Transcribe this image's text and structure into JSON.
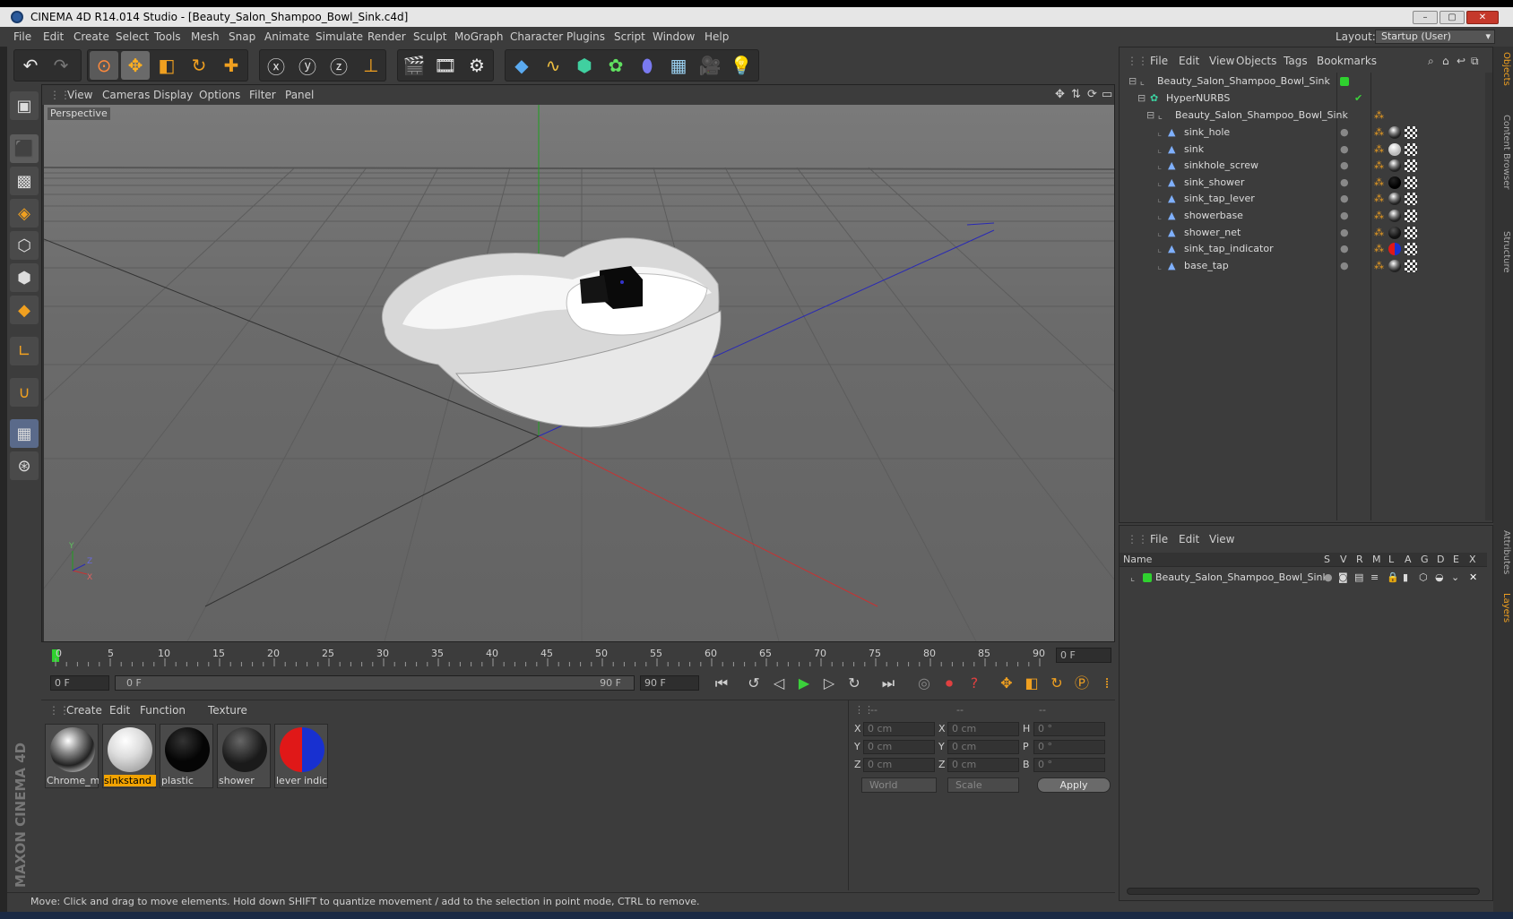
{
  "window": {
    "title": "CINEMA 4D R14.014 Studio - [Beauty_Salon_Shampoo_Bowl_Sink.c4d]",
    "controls": [
      "–",
      "▢",
      "✕"
    ]
  },
  "menubar": {
    "items": [
      "File",
      "Edit",
      "Create",
      "Select",
      "Tools",
      "Mesh",
      "Snap",
      "Animate",
      "Simulate",
      "Render",
      "Sculpt",
      "MoGraph",
      "Character",
      "Plugins",
      "Script",
      "Window",
      "Help"
    ],
    "layout_label": "Layout:",
    "layout_value": "Startup (User)"
  },
  "viewport": {
    "menu": [
      "View",
      "Cameras",
      "Display",
      "Options",
      "Filter",
      "Panel"
    ],
    "label": "Perspective",
    "axis": {
      "y": "Y",
      "z": "Z",
      "x": "X"
    }
  },
  "timeline": {
    "ticks": [
      "0",
      "5",
      "10",
      "15",
      "20",
      "25",
      "30",
      "35",
      "40",
      "45",
      "50",
      "55",
      "60",
      "65",
      "70",
      "75",
      "80",
      "85",
      "90"
    ],
    "current_frame": "0 F",
    "start_field": "0 F",
    "slider_start": "0 F",
    "slider_end": "90 F",
    "end_field": "90 F"
  },
  "materials": {
    "menu": [
      "Create",
      "Edit",
      "Function",
      "Texture"
    ],
    "items": [
      {
        "label": "Chrome_m",
        "kind": "chrome"
      },
      {
        "label": "sinkstand",
        "kind": "white",
        "selected": true
      },
      {
        "label": "plastic",
        "kind": "black"
      },
      {
        "label": "shower",
        "kind": "dark"
      },
      {
        "label": "lever indica",
        "kind": "redblue"
      }
    ]
  },
  "coordinates": {
    "headers": [
      "--",
      "--",
      "--"
    ],
    "rows": [
      {
        "l1": "X",
        "v1": "0 cm",
        "l2": "X",
        "v2": "0 cm",
        "l3": "H",
        "v3": "0 °"
      },
      {
        "l1": "Y",
        "v1": "0 cm",
        "l2": "Y",
        "v2": "0 cm",
        "l3": "P",
        "v3": "0 °"
      },
      {
        "l1": "Z",
        "v1": "0 cm",
        "l2": "Z",
        "v2": "0 cm",
        "l3": "B",
        "v3": "0 °"
      }
    ],
    "mode": "World",
    "scale": "Scale",
    "apply": "Apply"
  },
  "statusbar": {
    "text": "Move: Click and drag to move elements. Hold down SHIFT to quantize movement / add to the selection in point mode, CTRL to remove."
  },
  "objects": {
    "menu": [
      "File",
      "Edit",
      "View",
      "Objects",
      "Tags",
      "Bookmarks"
    ],
    "tree": [
      {
        "name": "Beauty_Salon_Shampoo_Bowl_Sink",
        "level": 0,
        "icon": "null-icon"
      },
      {
        "name": "HyperNURBS",
        "level": 1,
        "icon": "hypernurbs-icon"
      },
      {
        "name": "Beauty_Salon_Shampoo_Bowl_Sink",
        "level": 2,
        "icon": "null-icon"
      },
      {
        "name": "sink_hole",
        "level": 3,
        "icon": "polygon-icon",
        "mat": "chrome"
      },
      {
        "name": "sink",
        "level": 3,
        "icon": "polygon-icon",
        "mat": "white"
      },
      {
        "name": "sinkhole_screw",
        "level": 3,
        "icon": "polygon-icon",
        "mat": "chrome"
      },
      {
        "name": "sink_shower",
        "level": 3,
        "icon": "polygon-icon",
        "mat": "black"
      },
      {
        "name": "sink_tap_lever",
        "level": 3,
        "icon": "polygon-icon",
        "mat": "chrome"
      },
      {
        "name": "showerbase",
        "level": 3,
        "icon": "polygon-icon",
        "mat": "chrome"
      },
      {
        "name": "shower_net",
        "level": 3,
        "icon": "polygon-icon",
        "mat": "dark"
      },
      {
        "name": "sink_tap_indicator",
        "level": 3,
        "icon": "polygon-icon",
        "mat": "redblue"
      },
      {
        "name": "base_tap",
        "level": 3,
        "icon": "polygon-icon",
        "mat": "chrome"
      }
    ]
  },
  "layers": {
    "menu": [
      "File",
      "Edit",
      "View"
    ],
    "columns": [
      "Name",
      "S",
      "V",
      "R",
      "M",
      "L",
      "A",
      "G",
      "D",
      "E",
      "X"
    ],
    "rows": [
      {
        "name": "Beauty_Salon_Shampoo_Bowl_Sink"
      }
    ]
  },
  "side_tabs": [
    "Objects",
    "Content Browser",
    "Structure",
    "Attributes",
    "Layers"
  ],
  "branding": {
    "text": "MAXON CINEMA 4D"
  },
  "colors": {
    "accent": "#f2a300",
    "layer_green": "#2fd12f",
    "axis_x": "#c83232",
    "axis_y": "#1fa01f",
    "axis_z": "#2a2ab4"
  }
}
